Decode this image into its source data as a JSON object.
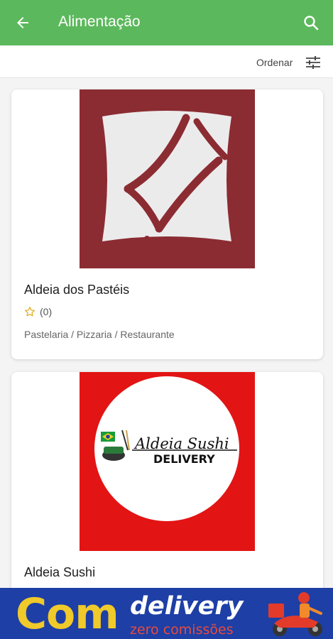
{
  "header": {
    "title": "Alimentação",
    "back_icon": "arrow-left-icon",
    "search_icon": "search-icon",
    "color": "#5cb85c"
  },
  "sort": {
    "label": "Ordenar",
    "icon": "tune-sliders-icon"
  },
  "stores": [
    {
      "name": "Aldeia dos Pastéis",
      "rating": "(0)",
      "category": "Pastelaria / Pizzaria / Restaurante",
      "logo_color": "#8b2c32"
    },
    {
      "name": "Aldeia Sushi",
      "logo_text": "Aldeia Sushi",
      "logo_subtext": "DELIVERY",
      "logo_color": "#e31414"
    }
  ],
  "banner": {
    "word1": "Com",
    "word2": "delivery",
    "subtitle": "zero comissões"
  }
}
